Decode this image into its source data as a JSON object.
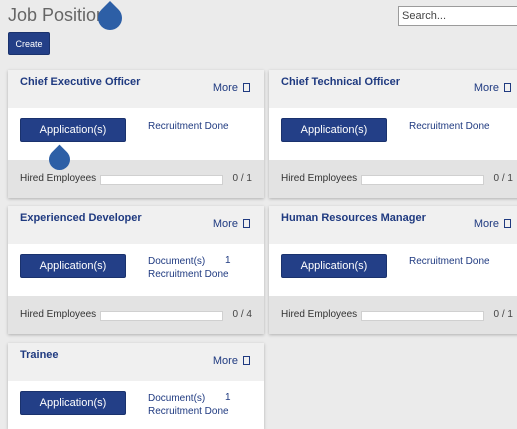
{
  "header": {
    "title": "Job Positions",
    "create_label": "Create",
    "search_placeholder": "Search..."
  },
  "cards": [
    {
      "title": "Chief Executive Officer",
      "more_label": "More",
      "applications_label": "Application(s)",
      "info": [
        "Recruitment Done"
      ],
      "counts": [],
      "hired_label": "Hired Employees",
      "hired_fraction": 0,
      "hired_ratio": "0 / 1"
    },
    {
      "title": "Chief Technical Officer",
      "more_label": "More",
      "applications_label": "Application(s)",
      "info": [
        "Recruitment Done"
      ],
      "counts": [],
      "hired_label": "Hired Employees",
      "hired_fraction": 0,
      "hired_ratio": "0 / 1"
    },
    {
      "title": "Experienced Developer",
      "more_label": "More",
      "applications_label": "Application(s)",
      "info": [
        "Document(s)",
        "Recruitment Done"
      ],
      "counts": [
        "1"
      ],
      "hired_label": "Hired Employees",
      "hired_fraction": 0,
      "hired_ratio": "0 / 4"
    },
    {
      "title": "Human Resources Manager",
      "more_label": "More",
      "applications_label": "Application(s)",
      "info": [
        "Recruitment Done"
      ],
      "counts": [],
      "hired_label": "Hired Employees",
      "hired_fraction": 0,
      "hired_ratio": "0 / 1"
    },
    {
      "title": "Trainee",
      "more_label": "More",
      "applications_label": "Application(s)",
      "info": [
        "Document(s)",
        "Recruitment Done"
      ],
      "counts": [
        "1"
      ],
      "hired_label": null,
      "hired_fraction": null,
      "hired_ratio": null
    }
  ],
  "icons": {
    "more_icon": "square-outline-icon",
    "cursor_marker": "droplet-icon"
  },
  "colors": {
    "accent": "#233f87",
    "link": "#1f3a80",
    "marker": "#2d5fa6"
  }
}
